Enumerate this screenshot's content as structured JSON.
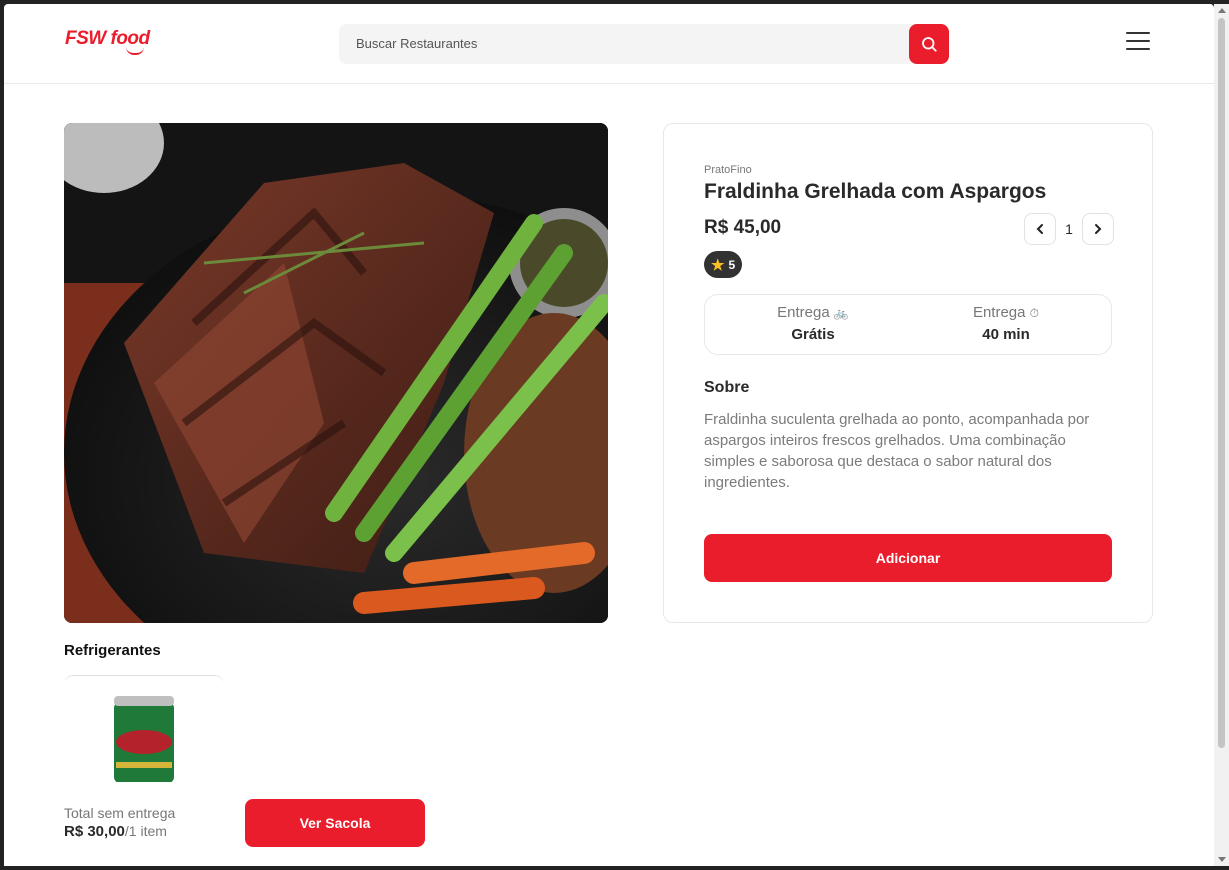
{
  "brand": {
    "logo_text": "FSW food",
    "accent": "#ea1d2c"
  },
  "header": {
    "search_placeholder": "Buscar Restaurantes",
    "search_icon": "search-icon",
    "menu_icon": "menu-icon"
  },
  "product": {
    "image_icon": "grilled-steak-with-asparagus-photo",
    "restaurant": "PratoFino",
    "name": "Fraldinha Grelhada com Aspargos",
    "price": "R$ 45,00",
    "quantity": "1",
    "rating": "5",
    "delivery": [
      {
        "label": "Entrega",
        "icon": "bike-icon",
        "value": "Grátis"
      },
      {
        "label": "Entrega",
        "icon": "timer-icon",
        "value": "40 min"
      }
    ],
    "about_title": "Sobre",
    "about_text": "Fraldinha suculenta grelhada ao ponto, acompanhada por aspargos inteiros frescos grelhados. Uma combinação simples e saborosa que destaca o sabor natural dos ingredientes.",
    "add_label": "Adicionar"
  },
  "recommendations": {
    "title": "Refrigerantes",
    "items": [
      {
        "image_icon": "guarana-can-photo"
      }
    ]
  },
  "footer": {
    "total_label": "Total sem entrega",
    "total_value": "R$ 30,00",
    "items_count": "/1 item",
    "bag_label": "Ver Sacola"
  }
}
